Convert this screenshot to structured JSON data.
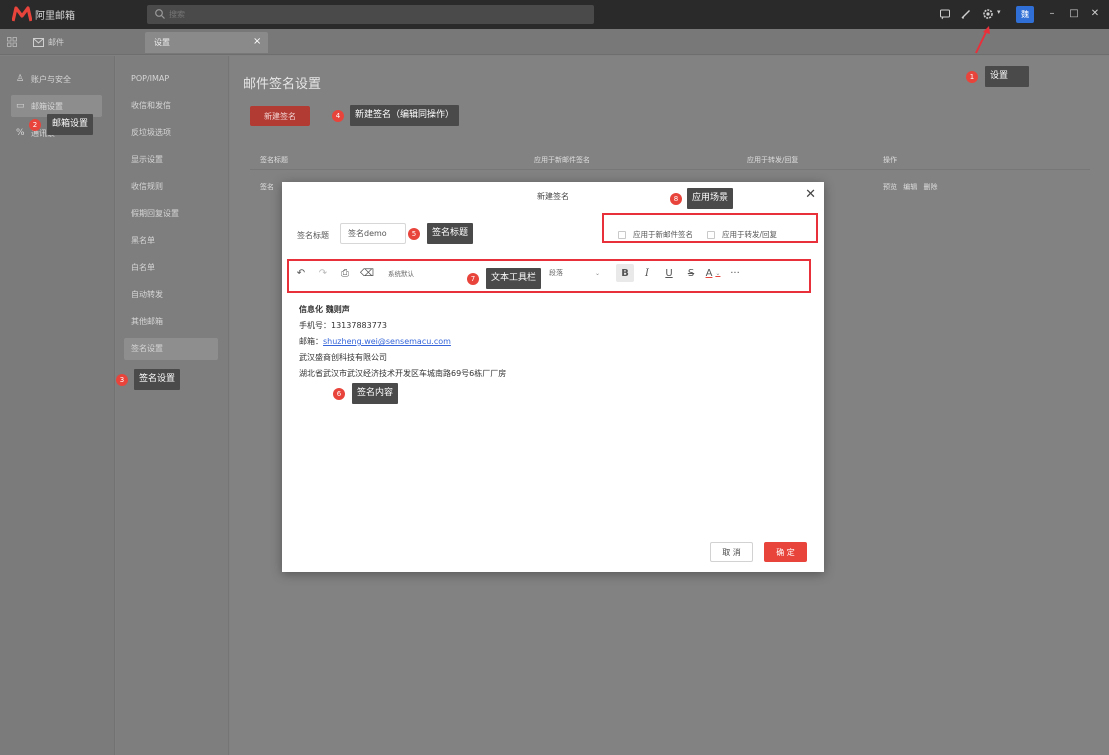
{
  "app": {
    "name": "阿里邮箱",
    "search_placeholder": "搜索",
    "avatar_text": "魏"
  },
  "tabs": {
    "mail_label": "邮件",
    "settings_label": "设置",
    "close_glyph": "×"
  },
  "sidebar": {
    "items": [
      {
        "label": "账户与安全",
        "icon": "user-icon"
      },
      {
        "label": "邮箱设置",
        "icon": "mail-settings-icon"
      },
      {
        "label": "通讯录",
        "icon": "contacts-icon"
      }
    ]
  },
  "subnav": {
    "items": [
      "POP/IMAP",
      "收信和发信",
      "反垃圾选项",
      "显示设置",
      "收信规则",
      "假期回复设置",
      "黑名单",
      "白名单",
      "自动转发",
      "其他邮箱",
      "签名设置"
    ]
  },
  "main": {
    "title": "邮件签名设置",
    "new_button": "新建签名",
    "table": {
      "columns": [
        "签名标题",
        "应用于新邮件签名",
        "应用于转发/回复",
        "操作"
      ],
      "row": {
        "title": "签名",
        "actions": [
          "预览",
          "编辑",
          "删除"
        ]
      }
    }
  },
  "modal": {
    "title": "新建签名",
    "close_glyph": "✕",
    "title_label": "签名标题",
    "title_value": "签名demo",
    "options": [
      "应用于新邮件签名",
      "应用于转发/回复"
    ],
    "toolbar": {
      "font_family": "系统默认",
      "paragraph": "段落",
      "bold": "B",
      "italic": "I",
      "underline": "U",
      "strike": "S",
      "font_color": "A",
      "more": "···"
    },
    "content": {
      "name_line": "信息化  魏则声",
      "phone": "手机号：13137883773",
      "email_label": "邮箱：",
      "email_value": "shuzheng.wei@sensemacu.com",
      "company": "武汉盛商创科技有限公司",
      "address": "湖北省武汉市武汉经济技术开发区车城南路69号6栋厂厂房"
    },
    "cancel": "取 消",
    "ok": "确 定"
  },
  "annotations": [
    {
      "num": "1",
      "text": "设置"
    },
    {
      "num": "2",
      "text": "邮箱设置"
    },
    {
      "num": "3",
      "text": "签名设置"
    },
    {
      "num": "4",
      "text": "新建签名（编辑同操作）"
    },
    {
      "num": "5",
      "text": "签名标题"
    },
    {
      "num": "6",
      "text": "签名内容"
    },
    {
      "num": "7",
      "text": "文本工具栏"
    },
    {
      "num": "8",
      "text": "应用场景"
    }
  ],
  "colors": {
    "brand_red": "#e8443b",
    "accent_blue": "#2f6fd6",
    "annotation_bg": "#4a4a4a"
  }
}
